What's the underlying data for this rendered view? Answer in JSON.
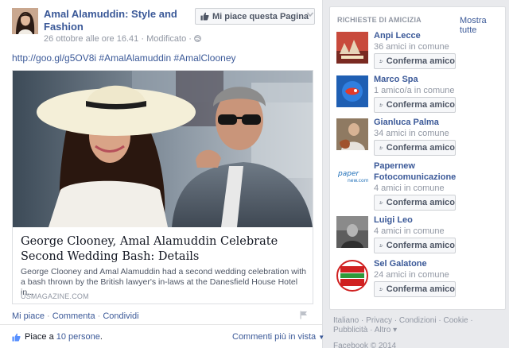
{
  "post": {
    "page_name": "Amal Alamuddin: Style and Fashion",
    "date": "26 ottobre alle ore 16.41",
    "meta_sep": "·",
    "edited": "Modificato",
    "like_page_label": "Mi piace questa Pagina",
    "link_text": "http://goo.gl/g5OV8i #AmalAlamuddin #AmalClooney",
    "share": {
      "title": "George Clooney, Amal Alamuddin Celebrate Second Wedding Bash: Details",
      "description": "George Clooney and Amal Alamuddin had a second wedding celebration with a bash thrown by the British lawyer's in-laws at the Danesfield House Hotel in...",
      "source": "USMAGAZINE.COM"
    },
    "actions": {
      "like": "Mi piace",
      "comment": "Commenta",
      "share": "Condividi",
      "sep": "·"
    },
    "likes": {
      "prefix": "Piace a",
      "count_link": "10 persone",
      "suffix": "."
    },
    "comments_sort": "Commenti più in vista"
  },
  "friend_requests": {
    "title": "RICHIESTE DI AMICIZIA",
    "show_all": "Mostra tutte",
    "confirm_label": "Conferma amico",
    "items": [
      {
        "name": "Anpi Lecce",
        "mutual": "36 amici in comune"
      },
      {
        "name": "Marco Spa",
        "mutual": "1 amico/a in comune"
      },
      {
        "name": "Gianluca Palma",
        "mutual": "34 amici in comune"
      },
      {
        "name": "Papernew Fotocomunicazione",
        "mutual": "4 amici in comune"
      },
      {
        "name": "Luigi Leo",
        "mutual": "4 amici in comune"
      },
      {
        "name": "Sel Galatone",
        "mutual": "24 amici in comune"
      }
    ]
  },
  "footer": {
    "links": [
      "Italiano",
      "Privacy",
      "Condizioni",
      "Cookie",
      "Pubblicità",
      "Altro"
    ],
    "sep": "·",
    "more_arrow": "▾",
    "copyright": "Facebook © 2014"
  },
  "icons": {
    "avatar_logo_text": "sinistra ecologia LIBERTÀ",
    "papernew_logo_text": "paper new.com"
  },
  "colors": {
    "link": "#3b5998",
    "muted": "#9197a3",
    "background": "#e9eaed"
  }
}
